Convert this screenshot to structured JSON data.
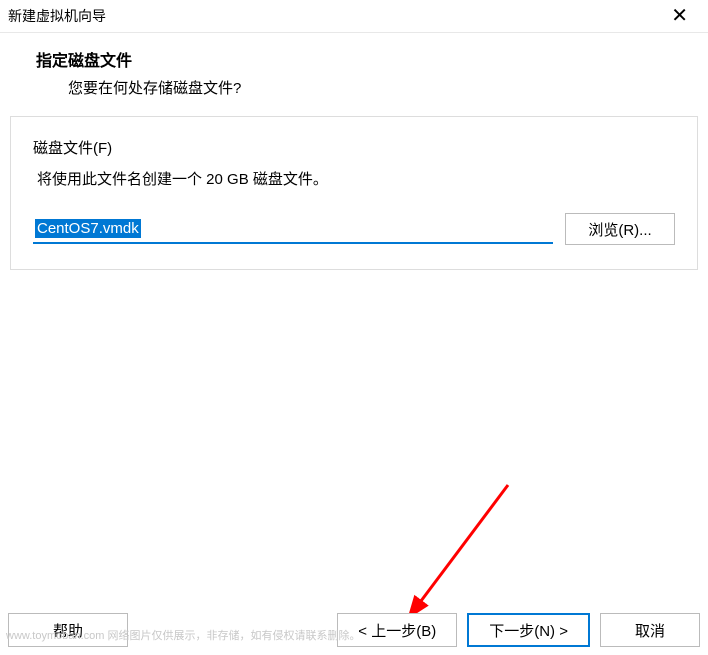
{
  "window": {
    "title": "新建虚拟机向导"
  },
  "header": {
    "title": "指定磁盘文件",
    "subtitle": "您要在何处存储磁盘文件?"
  },
  "content": {
    "fieldLabel": "磁盘文件(F)",
    "description": "将使用此文件名创建一个 20 GB 磁盘文件。",
    "fileValue": "CentOS7.vmdk",
    "browseLabel": "浏览(R)..."
  },
  "footer": {
    "help": "帮助",
    "back": "< 上一步(B)",
    "next": "下一步(N) >",
    "cancel": "取消"
  },
  "watermark": "www.toymoban.com 网络图片仅供展示，非存储，如有侵权请联系删除。"
}
